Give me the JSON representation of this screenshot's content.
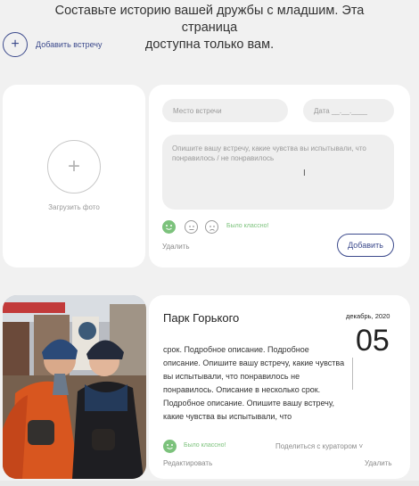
{
  "intro": {
    "line1": "Составьте историю вашей дружбы с младшим. Эта страница",
    "line2": "доступна только вам."
  },
  "add_meeting": {
    "icon": "plus-icon",
    "label": "Добавить встречу"
  },
  "new_entry": {
    "upload_label": "Загрузить фото",
    "place_placeholder": "Место встречи",
    "date_placeholder": "Дата  __.__.____",
    "description_placeholder": "Опишите вашу встречу, какие чувства вы испытывали, что понравилось / не понравилось",
    "mood_caption": "Было классно!",
    "delete_label": "Удалить",
    "add_label": "Добавить"
  },
  "entry": {
    "title": "Парк Горького",
    "month_year": "декабрь, 2020",
    "day": "05",
    "text": "срок. Подробное описание. Подробное описание. Опишите вашу встречу, какие чувства вы испытывали, что понравилось не понравилось. Описание в несколько срок. Подробное описание. Опишите вашу встречу, какие чувства вы испытывали, что",
    "mood_caption": "Было классно!",
    "share_label": "Поделиться с куратором ˅",
    "edit_label": "Редактировать",
    "delete_label": "Удалить"
  },
  "colors": {
    "accent": "#3c4a8c",
    "mood_green": "#7cc27c",
    "background": "#f1f1f1"
  }
}
